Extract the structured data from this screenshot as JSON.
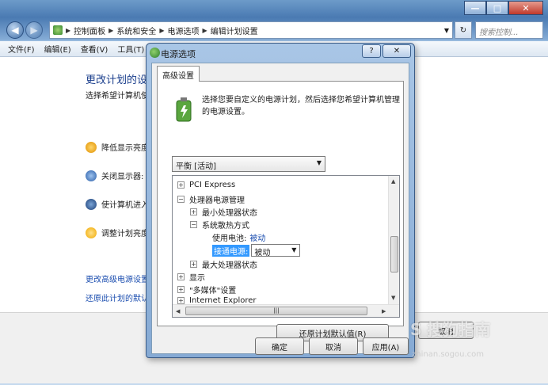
{
  "window": {
    "controls": {
      "minimize": "—",
      "maximize": "□",
      "close": "✕"
    }
  },
  "address": {
    "crumbs": [
      "控制面板",
      "系统和安全",
      "电源选项",
      "编辑计划设置"
    ],
    "search_placeholder": "搜索控制..."
  },
  "menu": [
    "文件(F)",
    "编辑(E)",
    "查看(V)",
    "工具(T)"
  ],
  "background": {
    "title": "更改计划的设",
    "desc": "选择希望计算机使",
    "rows": [
      "降低显示亮度",
      "关闭显示器:",
      "使计算机进入",
      "调整计划亮度"
    ],
    "links": [
      "更改高级电源设置",
      "还原此计划的默认"
    ],
    "cancel_label": "取消"
  },
  "dialog": {
    "title": "电源选项",
    "help": "?",
    "close": "✕",
    "tab": "高级设置",
    "intro": "选择您要自定义的电源计划，然后选择您希望计算机管理的电源设置。",
    "plan": "平衡 [活动]",
    "tree": {
      "pci": "PCI Express",
      "cpu": "处理器电源管理",
      "min_cpu": "最小处理器状态",
      "cooling": "系统散热方式",
      "battery_label": "使用电池:",
      "battery_value": "被动",
      "plugged_label": "接通电源:",
      "plugged_value": "被动",
      "max_cpu": "最大处理器状态",
      "display": "显示",
      "multimedia": "\"多媒体\"设置",
      "ie": "Internet Explorer"
    },
    "restore_button": "还原计划默认值(R)",
    "ok": "确定",
    "cancel": "取消",
    "apply": "应用(A)"
  },
  "watermark": {
    "main": "S 搜狗指南",
    "sub": "zhinan.sogou.com"
  }
}
